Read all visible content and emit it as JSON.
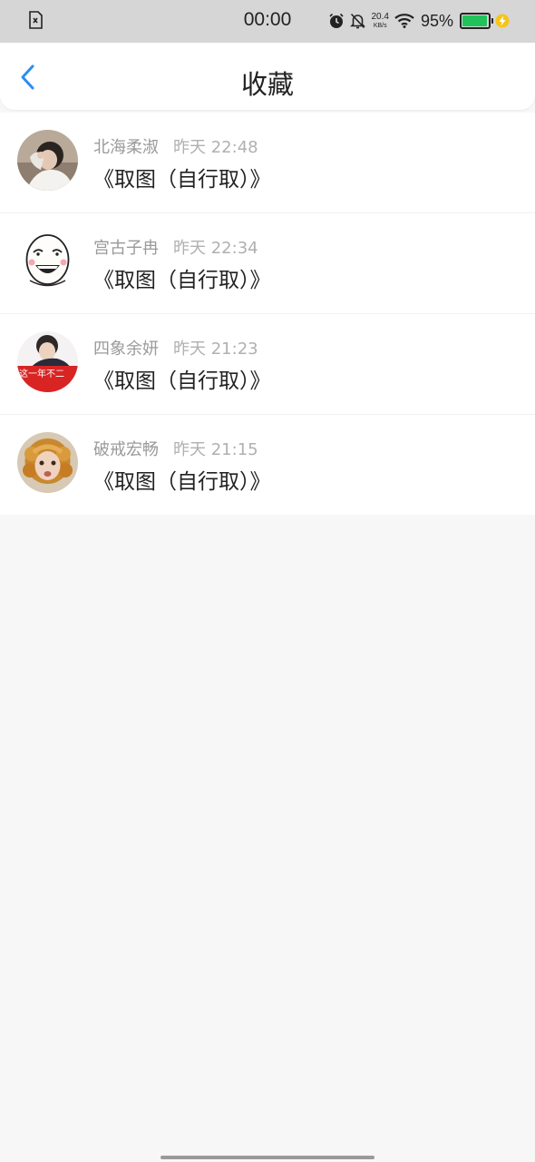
{
  "status_bar": {
    "time": "00:00",
    "net_speed_value": "20.4",
    "net_speed_unit": "KB/s",
    "battery_pct": "95%",
    "battery_level": 0.95,
    "icons": [
      "sim-card-icon",
      "alarm-icon",
      "bell-off-icon",
      "wifi-icon",
      "battery-icon",
      "charging-icon"
    ]
  },
  "header": {
    "title": "收藏",
    "back_icon": "chevron-left-icon"
  },
  "favorites": [
    {
      "name": "北海柔淑",
      "time": "昨天 22:48",
      "title": "《取图（自行取）》",
      "avatar": "avatar-photo"
    },
    {
      "name": "宫古子冉",
      "time": "昨天 22:34",
      "title": "《取图（自行取）》",
      "avatar": "avatar-meme"
    },
    {
      "name": "四象余妍",
      "time": "昨天 21:23",
      "title": "《取图（自行取）》",
      "avatar": "avatar-photo"
    },
    {
      "name": "破戒宏畅",
      "time": "昨天 21:15",
      "title": "《取图（自行取）》",
      "avatar": "avatar-photo"
    }
  ],
  "colors": {
    "accent": "#2b8ef0",
    "battery": "#21c25b",
    "charging": "#f5c518",
    "background": "#f8f7f8"
  }
}
